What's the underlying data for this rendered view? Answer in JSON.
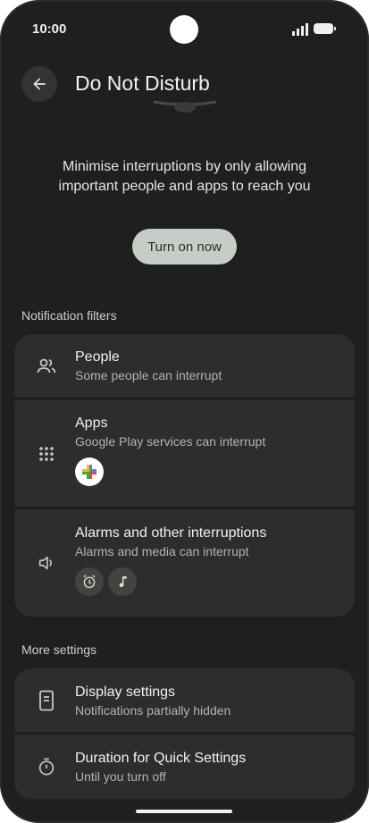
{
  "status_bar": {
    "time": "10:00"
  },
  "header": {
    "title": "Do Not Disturb"
  },
  "description": "Minimise interruptions by only allowing important people and apps to reach you",
  "turn_on_label": "Turn on now",
  "sections": {
    "notification_filters": "Notification filters",
    "more_settings": "More settings"
  },
  "filters": {
    "people": {
      "title": "People",
      "subtitle": "Some people can interrupt"
    },
    "apps": {
      "title": "Apps",
      "subtitle": "Google Play services can interrupt"
    },
    "alarms": {
      "title": "Alarms and other interruptions",
      "subtitle": "Alarms and media can interrupt"
    }
  },
  "more": {
    "display": {
      "title": "Display settings",
      "subtitle": "Notifications partially hidden"
    },
    "duration": {
      "title": "Duration for Quick Settings",
      "subtitle": "Until you turn off"
    }
  },
  "icons": {
    "back": "back-arrow-icon",
    "people": "people-icon",
    "apps": "apps-grid-icon",
    "play_services": "google-play-services-icon",
    "volume": "volume-icon",
    "alarm": "alarm-clock-icon",
    "music": "music-note-icon",
    "display": "phone-display-icon",
    "timer": "timer-icon"
  },
  "colors": {
    "background": "#1f201e",
    "card": "#2d2e2c",
    "button": "#c6cdc6",
    "text": "#f2f2ee",
    "subtext": "#b3b4ae"
  }
}
